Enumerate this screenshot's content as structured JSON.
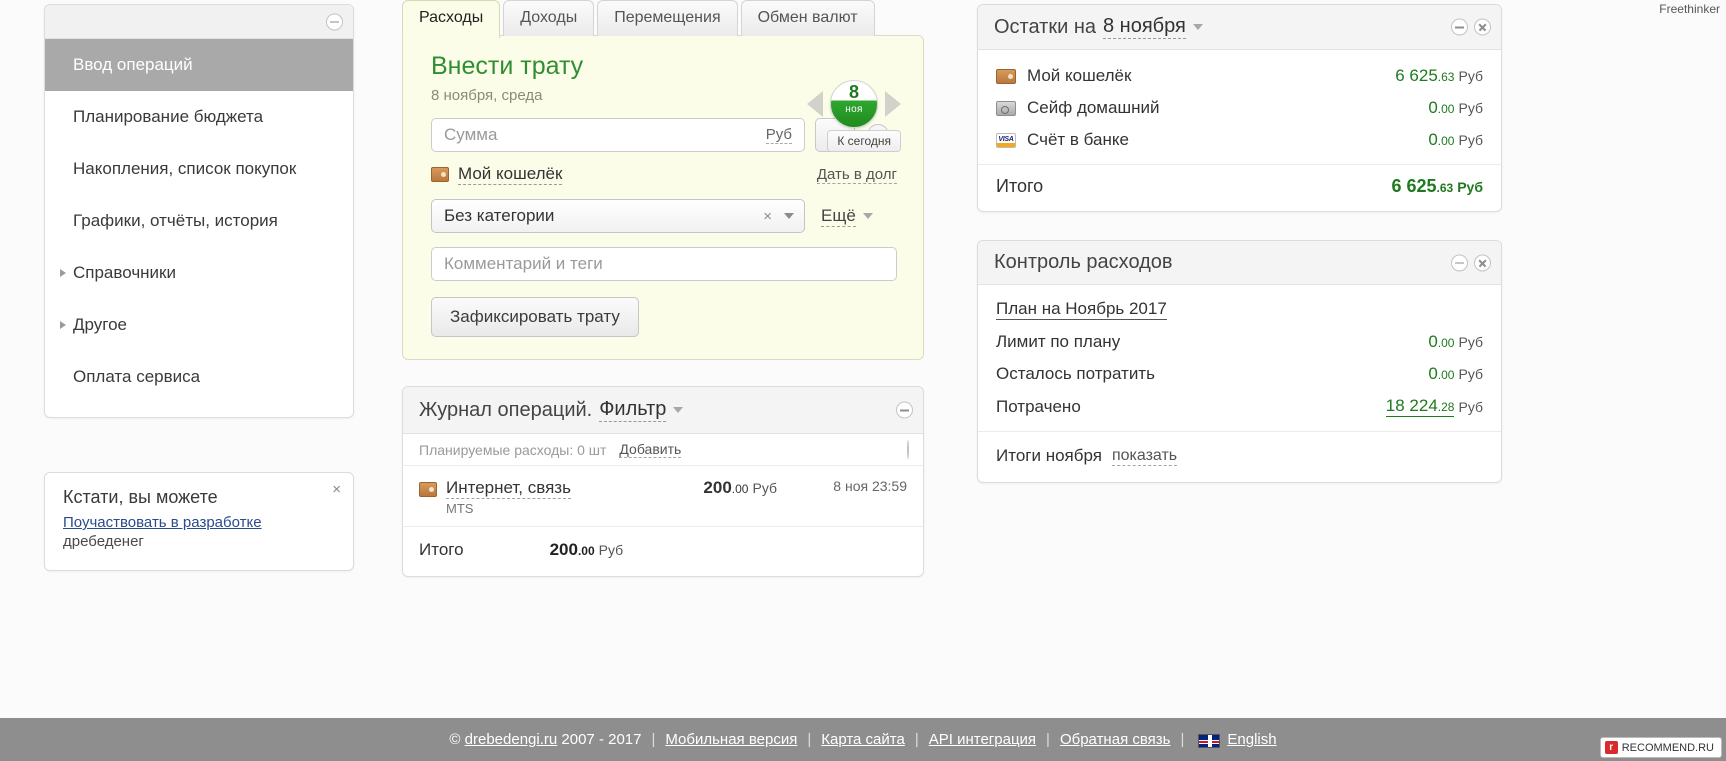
{
  "watermark": "Freethinker",
  "sidebar": {
    "items": [
      {
        "label": "Ввод операций",
        "active": true,
        "expandable": false
      },
      {
        "label": "Планирование бюджета",
        "active": false,
        "expandable": false
      },
      {
        "label": "Накопления, список покупок",
        "active": false,
        "expandable": false
      },
      {
        "label": "Графики, отчёты, история",
        "active": false,
        "expandable": false
      },
      {
        "label": "Справочники",
        "active": false,
        "expandable": true
      },
      {
        "label": "Другое",
        "active": false,
        "expandable": true
      },
      {
        "label": "Оплата сервиса",
        "active": false,
        "expandable": false
      }
    ]
  },
  "promo": {
    "title": "Кстати, вы можете",
    "link": "Поучаствовать в разработке",
    "sub": "дребеденег",
    "close": "×"
  },
  "tabs": [
    {
      "label": "Расходы",
      "active": true
    },
    {
      "label": "Доходы",
      "active": false
    },
    {
      "label": "Перемещения",
      "active": false
    },
    {
      "label": "Обмен валют",
      "active": false
    }
  ],
  "expense_form": {
    "title": "Внести трату",
    "date_label": "8 ноября, среда",
    "badge_day": "8",
    "badge_month": "ноя",
    "today_button": "К сегодня",
    "sum_placeholder": "Сумма",
    "currency": "Руб",
    "calc_button": "=",
    "info_button": "i",
    "wallet": "Мой кошелёк",
    "debt_link": "Дать в долг",
    "category": "Без категории",
    "category_clear": "×",
    "more_link": "Ещё",
    "comment_placeholder": "Комментарий и теги",
    "submit": "Зафиксировать трату"
  },
  "journal": {
    "title_static": "Журнал операций.",
    "title_filter": "Фильтр",
    "planned_label": "Планируемые расходы: 0 шт",
    "add_link": "Добавить",
    "operations": [
      {
        "category": "Интернет, связь",
        "note": "MTS",
        "amount_int": "200",
        "amount_cents": ".00",
        "currency": "Руб",
        "datetime": "8 ноя 23:59"
      }
    ],
    "total_label": "Итого",
    "total_int": "200",
    "total_cents": ".00",
    "total_currency": "Руб"
  },
  "balances": {
    "title_static": "Остатки на",
    "title_date": "8 ноября",
    "rows": [
      {
        "icon": "wallet-icon",
        "name": "Мой кошелёк",
        "int": "6 625",
        "cents": ".63",
        "currency": "Руб"
      },
      {
        "icon": "safe-icon",
        "name": "Сейф домашний",
        "int": "0",
        "cents": ".00",
        "currency": "Руб"
      },
      {
        "icon": "visa-icon",
        "name": "Счёт в банке",
        "int": "0",
        "cents": ".00",
        "currency": "Руб"
      }
    ],
    "total_label": "Итого",
    "total_int": "6 625",
    "total_cents": ".63",
    "total_currency": "Руб"
  },
  "expense_control": {
    "title": "Контроль расходов",
    "plan_link": "План на Ноябрь 2017",
    "rows": [
      {
        "name": "Лимит по плану",
        "int": "0",
        "cents": ".00",
        "currency": "Руб",
        "link": false
      },
      {
        "name": "Осталось потратить",
        "int": "0",
        "cents": ".00",
        "currency": "Руб",
        "link": false
      },
      {
        "name": "Потрачено",
        "int": "18 224",
        "cents": ".28",
        "currency": "Руб",
        "link": true
      }
    ],
    "footer_label": "Итоги ноября",
    "footer_link": "показать"
  },
  "footer": {
    "copyright_mark": "©",
    "site": "drebedengi.ru",
    "years": "2007 - 2017",
    "links": [
      "Мобильная версия",
      "Карта сайта",
      "API интеграция",
      "Обратная связь"
    ],
    "language": "English"
  },
  "recommend_badge": {
    "mark": "r",
    "text": "RECOMMEND.RU"
  },
  "colors": {
    "green": "#1f7a1f",
    "accent_form_bg": "#fcfde9",
    "active_menu": "#a9a9a9"
  }
}
